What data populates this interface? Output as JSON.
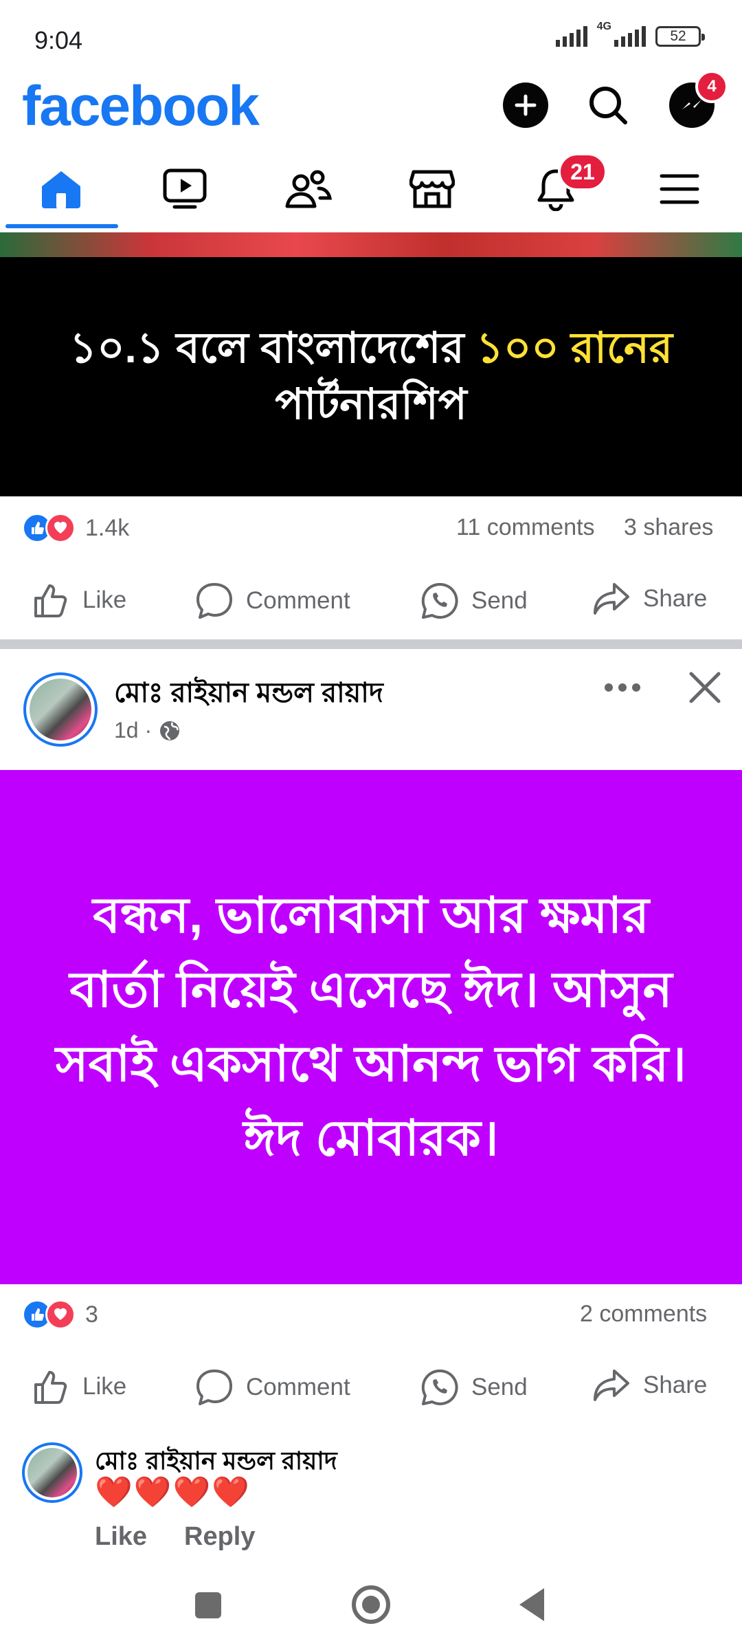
{
  "status_bar": {
    "time": "9:04",
    "network": "4G",
    "battery": "52"
  },
  "header": {
    "logo": "facebook",
    "messenger_badge": "4",
    "icons": [
      "plus-icon",
      "search-icon",
      "messenger-icon"
    ]
  },
  "tabs": [
    {
      "name": "home",
      "icon": "home-icon",
      "active": true
    },
    {
      "name": "video",
      "icon": "video-icon"
    },
    {
      "name": "friends",
      "icon": "friends-icon"
    },
    {
      "name": "marketplace",
      "icon": "marketplace-icon"
    },
    {
      "name": "notifications",
      "icon": "bell-icon",
      "badge": "21"
    },
    {
      "name": "menu",
      "icon": "menu-icon"
    }
  ],
  "post1": {
    "text_white": "১০.১ বলে বাংলাদেশের ",
    "text_yellow": "১০০ রানের",
    "text_line2": "পার্টনারশিপ",
    "reaction_count": "1.4k",
    "comments": "11 comments",
    "shares": "3 shares"
  },
  "actions": {
    "like": "Like",
    "comment": "Comment",
    "send": "Send",
    "share": "Share"
  },
  "post2": {
    "author": "মোঃ রাইয়ান মন্ডল রায়াদ",
    "time": "1d ·",
    "text": "বন্ধন, ভালোবাসা আর ক্ষমার বার্তা নিয়েই এসেছে ঈদ। আসুন সবাই একসাথে আনন্দ ভাগ করি। ঈদ মোবারক।",
    "background_color": "#bf00ff",
    "reaction_count": "3",
    "comments": "2 comments"
  },
  "comment": {
    "author": "মোঃ রাইয়ান মন্ডল রায়াদ",
    "text": "❤️❤️❤️❤️",
    "like": "Like",
    "reply": "Reply"
  },
  "colors": {
    "brand": "#1877f2",
    "badge": "#e41e3f",
    "muted": "#65676b"
  }
}
